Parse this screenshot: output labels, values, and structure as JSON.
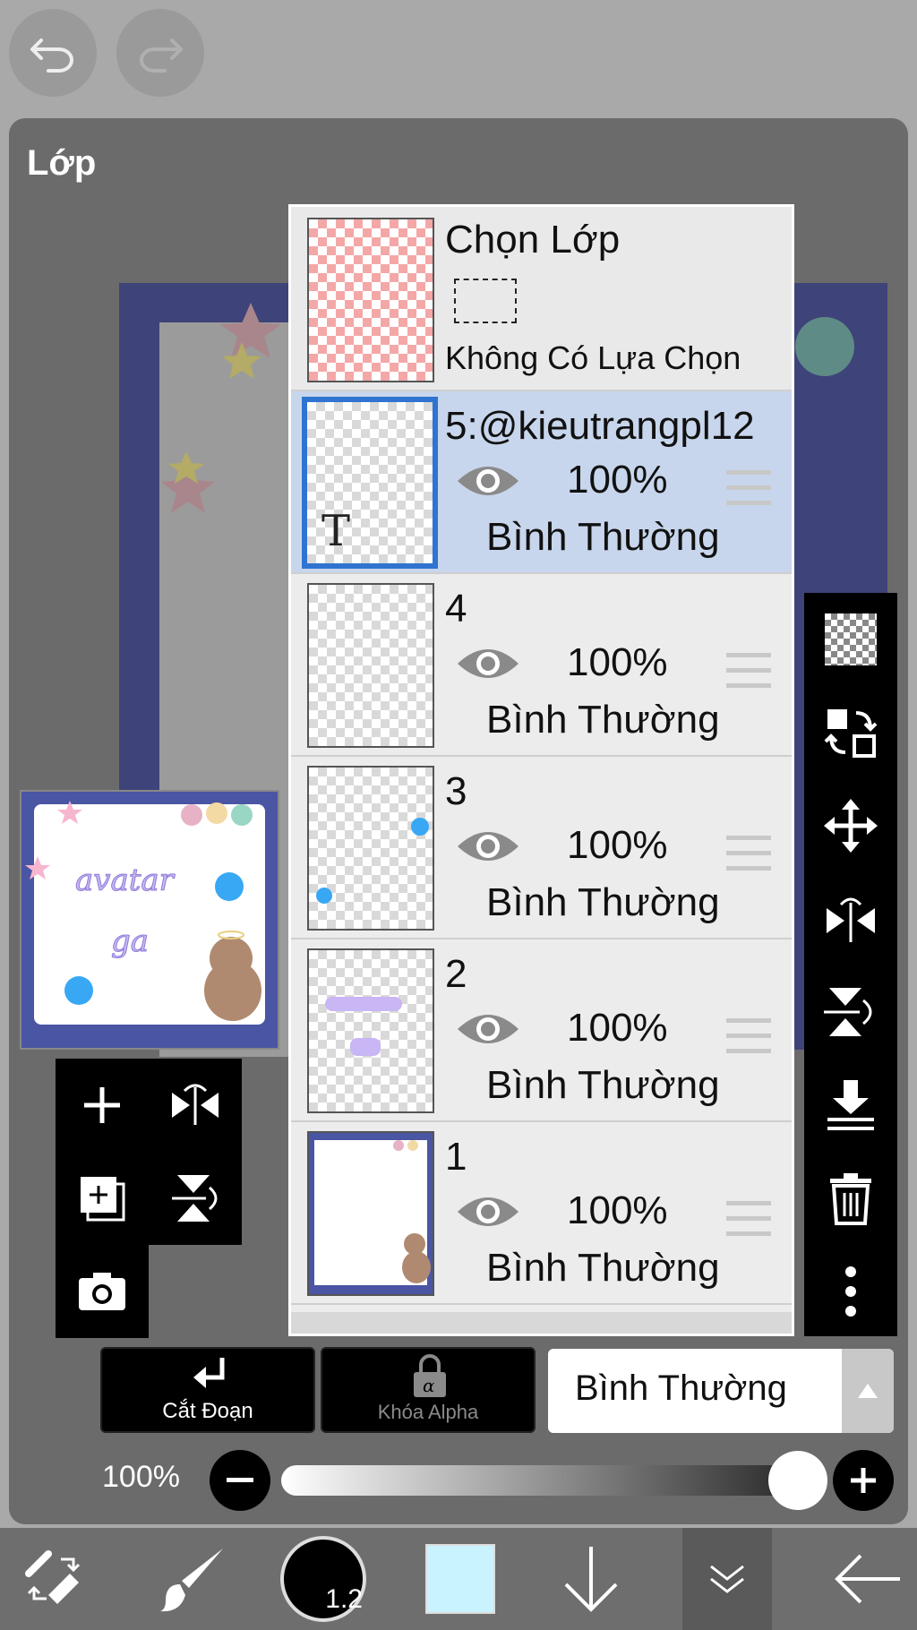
{
  "dialog": {
    "title": "Lớp"
  },
  "selection_row": {
    "title": "Chọn Lớp",
    "subtitle": "Không Có Lựa Chọn"
  },
  "layers": [
    {
      "name": "5:@kieutrangpl12",
      "opacity": "100%",
      "blend": "Bình Thường",
      "visible": true,
      "active": true,
      "thumb_text": "T"
    },
    {
      "name": "4",
      "opacity": "100%",
      "blend": "Bình Thường",
      "visible": true,
      "active": false
    },
    {
      "name": "3",
      "opacity": "100%",
      "blend": "Bình Thường",
      "visible": true,
      "active": false
    },
    {
      "name": "2",
      "opacity": "100%",
      "blend": "Bình Thường",
      "visible": true,
      "active": false
    },
    {
      "name": "1",
      "opacity": "100%",
      "blend": "Bình Thường",
      "visible": true,
      "active": false
    }
  ],
  "bottom": {
    "clip_label": "Cắt Đoạn",
    "alpha_lock_label": "Khóa Alpha",
    "blend_mode": "Bình Thường",
    "opacity_label": "100%",
    "opacity_value": 1.0
  },
  "toolbar": {
    "brush_size": "1.2",
    "color": "#c9f3ff"
  },
  "colors": {
    "accent": "#2f74d0",
    "active_row": "#c7d6ec",
    "canvas_frame": "#3e4379"
  }
}
